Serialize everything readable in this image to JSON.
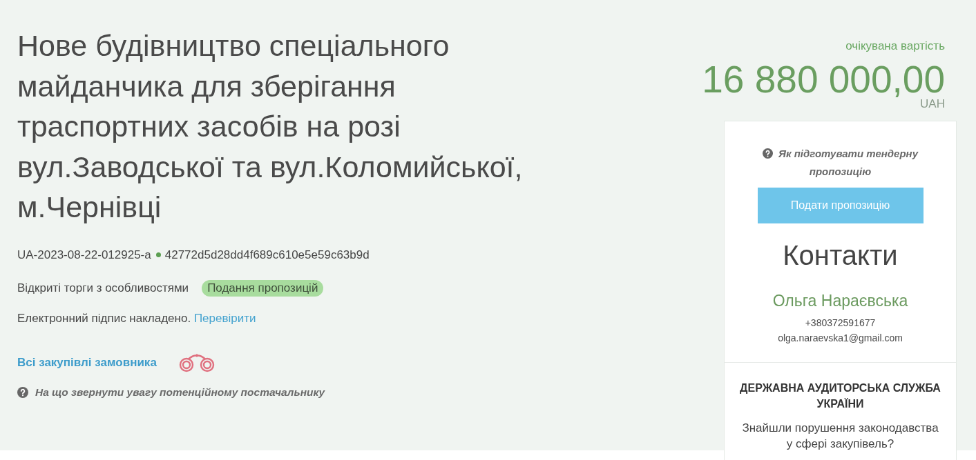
{
  "title": "Нове будівництво спеціального майданчика для зберігання траспортних засобів на розі вул.Заводської та вул.Коломийської, м.Чернівці",
  "tender": {
    "id": "UA-2023-08-22-012925-a",
    "hash": "42772d5d28dd4f689c610e5e59c63b9d"
  },
  "procedure": {
    "type": "Відкриті торги з особливостями",
    "status": "Подання пропозицій"
  },
  "signature": {
    "text": "Електронний підпис накладено.",
    "link": "Перевірити"
  },
  "buyer_link": "Всі закупівлі замовника",
  "supplier_hint": "На що звернути увагу потенційному постачальнику",
  "value": {
    "label": "очікувана вартість",
    "amount": "16 880 000,00",
    "currency": "UAH"
  },
  "sidebar": {
    "help_link": "Як підготувати тендерну пропозицію",
    "submit_button": "Подати пропозицію",
    "contacts": {
      "heading": "Контакти",
      "name": "Ольга Нараєвська",
      "phone": "+380372591677",
      "email": "olga.naraevska1@gmail.com"
    },
    "audit": {
      "title": "ДЕРЖАВНА АУДИТОРСЬКА СЛУЖБА УКРАЇНИ",
      "text": "Знайшли порушення законодавства у сфері закупівель?"
    }
  }
}
